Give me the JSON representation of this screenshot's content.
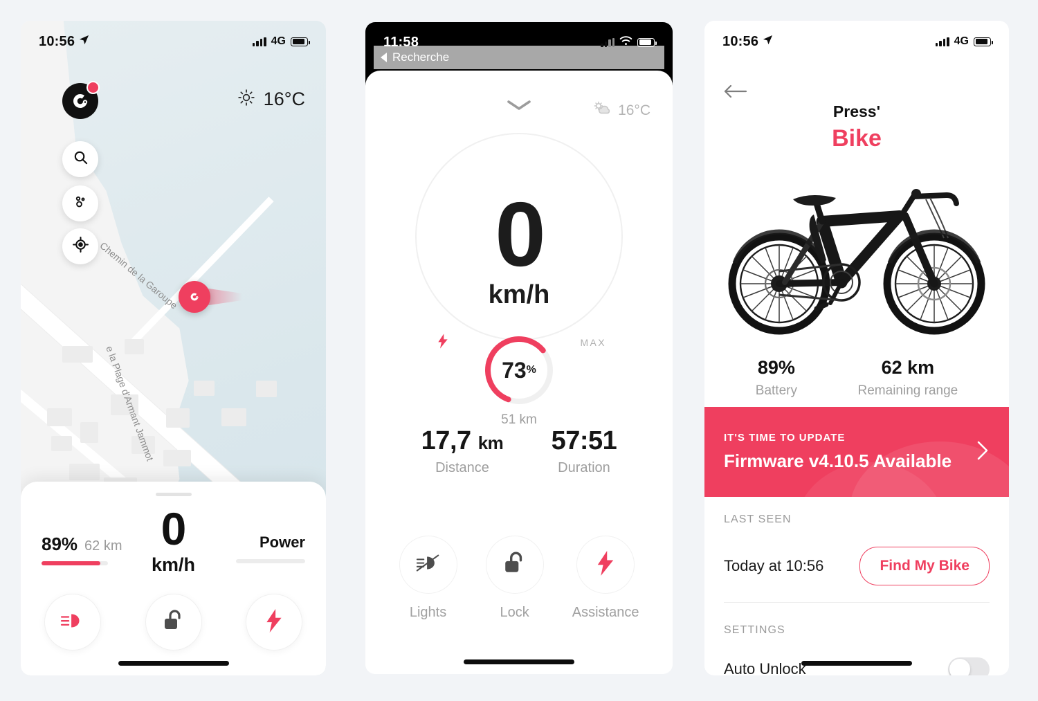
{
  "accent": "#ef3f5f",
  "map_screen": {
    "status": {
      "time": "10:56",
      "network": "4G",
      "location_arrow": "location-arrow-icon"
    },
    "weather": {
      "icon": "sun-icon",
      "temperature": "16°C"
    },
    "logo": {
      "name": "cowboy-logo",
      "badge": "notification-dot"
    },
    "controls": [
      {
        "name": "search",
        "icon": "search-icon"
      },
      {
        "name": "layers",
        "icon": "dots-layers-icon"
      },
      {
        "name": "locate",
        "icon": "crosshair-icon"
      }
    ],
    "streets": [
      "Chemin de la Garoupe",
      "e la Plage d'Armant Jammot"
    ],
    "marker": {
      "name": "bike-marker",
      "icon": "cowboy-logo"
    },
    "sheet": {
      "battery_percent": "89%",
      "battery_range": "62 km",
      "battery_fill": 89,
      "speed_value": "0",
      "speed_unit": "km/h",
      "power_label": "Power",
      "buttons": [
        {
          "name": "lights",
          "icon": "headlight-icon"
        },
        {
          "name": "lock",
          "icon": "unlock-padlock-icon"
        },
        {
          "name": "assistance",
          "icon": "lightning-bolt-icon"
        }
      ]
    }
  },
  "ride_screen": {
    "status": {
      "time": "11:58",
      "wifi": "wifi-icon"
    },
    "return_banner": {
      "label": "Recherche",
      "icon": "triangle-left-icon"
    },
    "collapse_icon": "chevron-down-icon",
    "weather": {
      "icon": "partly-cloudy-icon",
      "temperature": "16°C"
    },
    "speed_value": "0",
    "speed_unit": "km/h",
    "max_label": "MAX",
    "assist_icon": "lightning-bolt-icon",
    "battery": {
      "percent_value": "73",
      "percent_symbol": "%",
      "range": "51 km",
      "fill": 73
    },
    "stats": [
      {
        "value": "17,7",
        "unit": "km",
        "label": "Distance"
      },
      {
        "value": "57:51",
        "unit": "",
        "label": "Duration"
      }
    ],
    "actions": [
      {
        "label": "Lights",
        "icon": "headlight-off-icon"
      },
      {
        "label": "Lock",
        "icon": "unlock-padlock-icon"
      },
      {
        "label": "Assistance",
        "icon": "lightning-bolt-icon"
      }
    ]
  },
  "bike_screen": {
    "status": {
      "time": "10:56",
      "network": "4G",
      "location_arrow": "location-arrow-icon"
    },
    "back_icon": "arrow-left-icon",
    "brand": "Press'",
    "model": "Bike",
    "bike_image": "ebike-side-view",
    "stats": [
      {
        "value": "89%",
        "label": "Battery"
      },
      {
        "value": "62 km",
        "label": "Remaining range"
      }
    ],
    "firmware": {
      "kicker": "IT'S TIME TO UPDATE",
      "title": "Firmware v4.10.5 Available",
      "chevron": "chevron-right-icon"
    },
    "last_seen": {
      "kicker": "LAST SEEN",
      "value": "Today at 10:56",
      "button": "Find My Bike"
    },
    "settings": {
      "kicker": "SETTINGS",
      "rows": [
        {
          "label": "Auto Unlock",
          "state": "off"
        }
      ]
    }
  }
}
